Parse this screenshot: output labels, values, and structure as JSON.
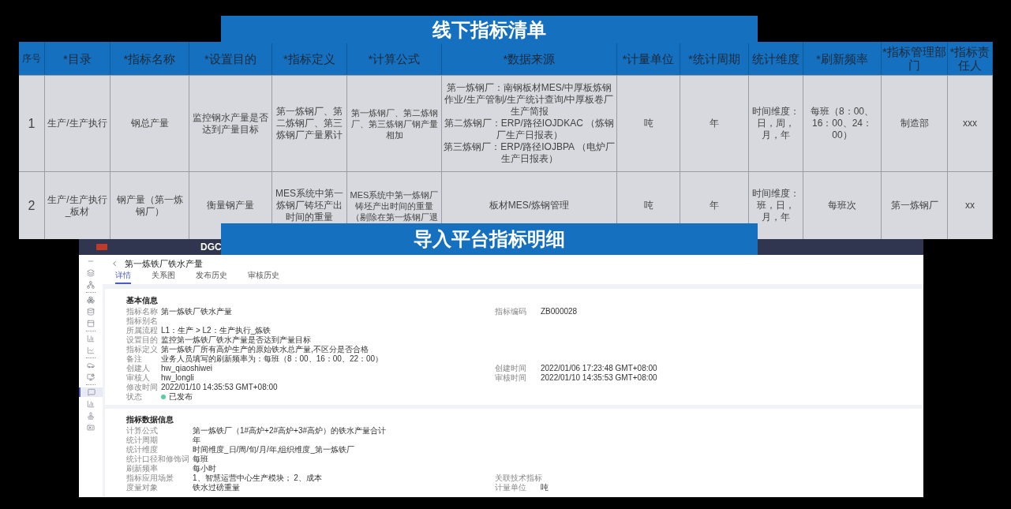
{
  "offline_list": {
    "title": "线下指标清单",
    "columns": [
      "序号",
      "*目录",
      "*指标名称",
      "*设置目的",
      "*指标定义",
      "*计算公式",
      "*数据来源",
      "*计量单位",
      "*统计周期",
      "统计维度",
      "*刷新频率",
      "*指标管理部门",
      "*指标责任人"
    ],
    "rows": [
      [
        "1",
        "生产/生产执行",
        "钢总产量",
        "监控钢水产量是否达到产量目标",
        "第一炼钢厂、第二炼钢厂、第三炼钢厂产量累计",
        "第一炼钢厂、第二炼钢厂、第三炼钢厂钢产量相加",
        [
          "第一炼钢厂：南钢板材MES/中厚板炼钢作业/生产管制/生产统计查询/中厚板卷厂生产简报",
          "第二炼钢厂：ERP/路径IOJDKAC （炼钢厂生产日报表）",
          "第三炼钢厂：ERP/路径IOJBPA （电炉厂生产日报表）"
        ],
        "吨",
        "年",
        "时间维度：日，周，月，年",
        "每班（8：00、16：00、24：00）",
        "制造部",
        "xxx"
      ],
      [
        "2",
        "生产/生产执行_板材",
        "钢产量（第一炼钢厂）",
        "衡量钢产量",
        "MES系统中第一炼钢厂铸坯产出时间的重量",
        "MES系统中第一炼钢厂铸坯产出时间的重量（剔除在第一炼钢厂退",
        "板材MES/炼钢管理",
        "吨",
        "年",
        "时间维度：班，日，月，年",
        "每班次",
        "第一炼钢厂",
        "xx"
      ]
    ]
  },
  "platform_banner": {
    "title": "导入平台指标明细"
  },
  "platform_app": {
    "brand": "DGC",
    "page_title": "第一炼铁厂铁水产量",
    "tabs": [
      {
        "label": "详情",
        "selected": true
      },
      {
        "label": "关系图",
        "selected": false
      },
      {
        "label": "发布历史",
        "selected": false
      },
      {
        "label": "审核历史",
        "selected": false
      }
    ],
    "sidebar_items": [
      {
        "selected": false
      },
      {
        "selected": false
      },
      {
        "selected": false
      },
      {
        "selected": false
      },
      {
        "selected": false
      },
      {
        "selected": false
      },
      {
        "selected": false
      },
      {
        "selected": false
      },
      {
        "selected": false
      },
      {
        "selected": false
      },
      {
        "selected": true
      },
      {
        "selected": false
      },
      {
        "selected": false
      },
      {
        "selected": false
      }
    ],
    "sections": [
      {
        "title": "基本信息",
        "rows": [
          {
            "label": "指标名称",
            "value": "第一炼铁厂铁水产量",
            "right_label": "指标编码",
            "right_value": "ZB000028"
          },
          {
            "label": "指标别名"
          },
          {
            "label": "所属流程",
            "value": "L1：生产 > L2：生产执行_炼铁"
          },
          {
            "label": "设置目的",
            "value": "监控第一炼铁厂铁水产量是否达到产量目标"
          },
          {
            "label": "指标定义",
            "value": "第一炼铁厂所有高炉生产的原始铁水总产量,不区分是否合格"
          },
          {
            "label": "备注",
            "value": "业务人员填写的刷新频率为：每班（8：00、16：00、22：00）"
          },
          {
            "label": "创建人",
            "value": "hw_qiaoshiwei",
            "right_label": "创建时间",
            "right_value": "2022/01/06 17:23:48 GMT+08:00"
          },
          {
            "label": "审核人",
            "value": "hw_longli",
            "right_label": "审核时间",
            "right_value": "2022/01/10 14:35:53 GMT+08:00"
          },
          {
            "label": "修改时间",
            "value": "2022/01/10 14:35:53 GMT+08:00"
          },
          {
            "label": "状态",
            "value": "已发布",
            "color": "#5cc9a7"
          }
        ]
      },
      {
        "title": "指标数据信息",
        "rows": [
          {
            "label": "计算公式",
            "value": "第一炼铁厂（1#高炉+2#高炉+3#高炉）的铁水产量合计"
          },
          {
            "label": "统计周期",
            "value": "年"
          },
          {
            "label": "统计维度",
            "value": "时间维度_日/周/旬/月/年,组织维度_第一炼铁厂"
          },
          {
            "label": "统计口径和修饰词",
            "value": "每班"
          },
          {
            "label": "刷新频率",
            "value": "每小时"
          },
          {
            "label": "指标应用场景",
            "value": "1、智慧运营中心生产模块； 2、成本",
            "right_label": "关联技术指标"
          },
          {
            "label": "度量对象",
            "value": "铁水过磅重量",
            "right_label": "计量单位",
            "right_value": "吨"
          }
        ]
      }
    ]
  }
}
